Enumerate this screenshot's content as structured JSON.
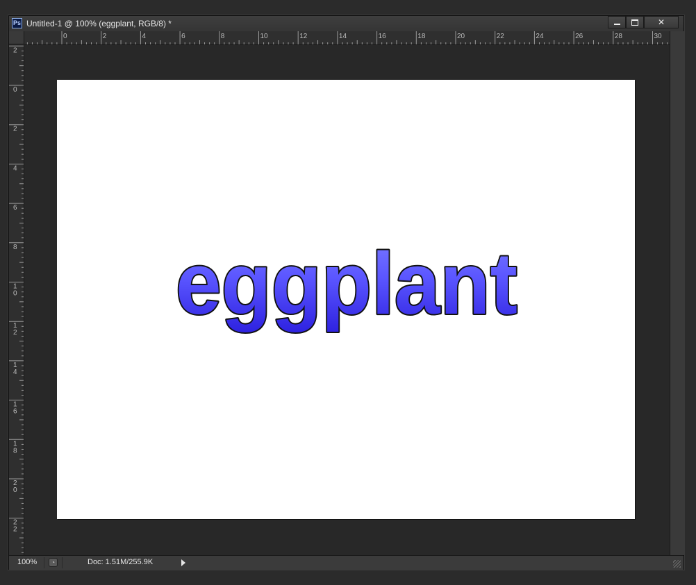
{
  "app_icon": {
    "name": "photoshop-icon",
    "label": "Ps"
  },
  "window": {
    "title": "Untitled-1 @ 100% (eggplant, RGB/8) *",
    "buttons": {
      "minimize": "minimize",
      "maximize": "maximize",
      "close": "close"
    }
  },
  "rulers": {
    "top_labels": [
      "0",
      "2",
      "4",
      "6",
      "8",
      "10",
      "12",
      "14",
      "16",
      "18",
      "20",
      "22",
      "24",
      "26",
      "28",
      "30"
    ],
    "left_labels": [
      [
        "2"
      ],
      [
        "0"
      ],
      [
        "2"
      ],
      [
        "4"
      ],
      [
        "6"
      ],
      [
        "8"
      ],
      [
        "1",
        "0"
      ],
      [
        "1",
        "2"
      ],
      [
        "1",
        "4"
      ],
      [
        "1",
        "6"
      ],
      [
        "1",
        "8"
      ],
      [
        "2",
        "0"
      ],
      [
        "2",
        "2"
      ]
    ]
  },
  "document": {
    "text_layer": "eggplant",
    "text_fill_top": "#7a7bff",
    "text_fill_bottom": "#2e22e0",
    "text_stroke": "#111111",
    "background": "#ffffff"
  },
  "status": {
    "zoom": "100%",
    "doc_info": "Doc: 1.51M/255.9K"
  }
}
